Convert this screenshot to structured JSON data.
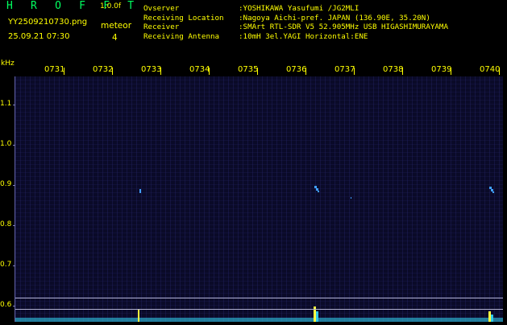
{
  "header": {
    "brand": "H R O F F T",
    "version": "1.0.0f",
    "filename": "YY2509210730.png",
    "datetime": "25.09.21 07:30",
    "category": "meteor",
    "count": "4"
  },
  "station": [
    {
      "label": "Ovserver",
      "value": ":YOSHIKAWA Yasufumi /JG2MLI"
    },
    {
      "label": "Receiving Location",
      "value": ":Nagoya Aichi-pref. JAPAN (136.90E, 35.20N)"
    },
    {
      "label": "Receiver",
      "value": ":SMArt RTL-SDR V5 52.905MHz USB HIGASHIMURAYAMA"
    },
    {
      "label": "Receiving Antenna",
      "value": ":10mH 3el.YAGI Horizontal:ENE"
    }
  ],
  "axis": {
    "y_unit": "kHz",
    "y_ticks": [
      "1.1",
      "1.0",
      "0.9",
      "0.8",
      "0.7",
      "0.6"
    ],
    "time_labels": [
      "0731",
      "0732",
      "0733",
      "0734",
      "0735",
      "0736",
      "0737",
      "0738",
      "0739",
      "0740"
    ]
  },
  "colors": {
    "text": "#ffff00",
    "brand": "#00ff60",
    "background": "#0a0a28",
    "signal": "#40a0ff"
  }
}
